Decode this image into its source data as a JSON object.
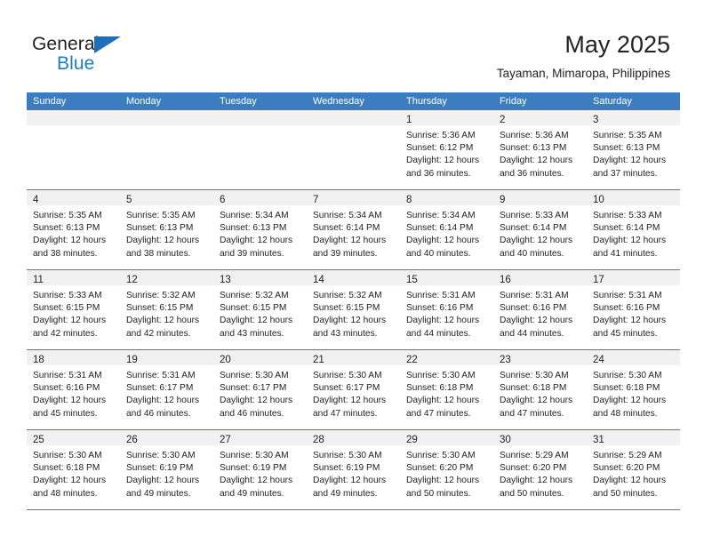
{
  "brand": {
    "name_part1": "General",
    "name_part2": "Blue",
    "color_dark": "#231f20",
    "color_blue": "#1e7bc4"
  },
  "header": {
    "title": "May 2025",
    "subtitle": "Tayaman, Mimaropa, Philippines"
  },
  "theme": {
    "header_bar_color": "#3b7dc0",
    "day_band_color": "#f1f1f1",
    "row_divider_color": "#3b7dc0",
    "text_color": "#222222"
  },
  "weekdays": [
    "Sunday",
    "Monday",
    "Tuesday",
    "Wednesday",
    "Thursday",
    "Friday",
    "Saturday"
  ],
  "weeks": [
    {
      "days": [
        {
          "number": "",
          "lines": []
        },
        {
          "number": "",
          "lines": []
        },
        {
          "number": "",
          "lines": []
        },
        {
          "number": "",
          "lines": []
        },
        {
          "number": "1",
          "lines": [
            "Sunrise: 5:36 AM",
            "Sunset: 6:12 PM",
            "Daylight: 12 hours",
            "and 36 minutes."
          ]
        },
        {
          "number": "2",
          "lines": [
            "Sunrise: 5:36 AM",
            "Sunset: 6:13 PM",
            "Daylight: 12 hours",
            "and 36 minutes."
          ]
        },
        {
          "number": "3",
          "lines": [
            "Sunrise: 5:35 AM",
            "Sunset: 6:13 PM",
            "Daylight: 12 hours",
            "and 37 minutes."
          ]
        }
      ]
    },
    {
      "days": [
        {
          "number": "4",
          "lines": [
            "Sunrise: 5:35 AM",
            "Sunset: 6:13 PM",
            "Daylight: 12 hours",
            "and 38 minutes."
          ]
        },
        {
          "number": "5",
          "lines": [
            "Sunrise: 5:35 AM",
            "Sunset: 6:13 PM",
            "Daylight: 12 hours",
            "and 38 minutes."
          ]
        },
        {
          "number": "6",
          "lines": [
            "Sunrise: 5:34 AM",
            "Sunset: 6:13 PM",
            "Daylight: 12 hours",
            "and 39 minutes."
          ]
        },
        {
          "number": "7",
          "lines": [
            "Sunrise: 5:34 AM",
            "Sunset: 6:14 PM",
            "Daylight: 12 hours",
            "and 39 minutes."
          ]
        },
        {
          "number": "8",
          "lines": [
            "Sunrise: 5:34 AM",
            "Sunset: 6:14 PM",
            "Daylight: 12 hours",
            "and 40 minutes."
          ]
        },
        {
          "number": "9",
          "lines": [
            "Sunrise: 5:33 AM",
            "Sunset: 6:14 PM",
            "Daylight: 12 hours",
            "and 40 minutes."
          ]
        },
        {
          "number": "10",
          "lines": [
            "Sunrise: 5:33 AM",
            "Sunset: 6:14 PM",
            "Daylight: 12 hours",
            "and 41 minutes."
          ]
        }
      ]
    },
    {
      "days": [
        {
          "number": "11",
          "lines": [
            "Sunrise: 5:33 AM",
            "Sunset: 6:15 PM",
            "Daylight: 12 hours",
            "and 42 minutes."
          ]
        },
        {
          "number": "12",
          "lines": [
            "Sunrise: 5:32 AM",
            "Sunset: 6:15 PM",
            "Daylight: 12 hours",
            "and 42 minutes."
          ]
        },
        {
          "number": "13",
          "lines": [
            "Sunrise: 5:32 AM",
            "Sunset: 6:15 PM",
            "Daylight: 12 hours",
            "and 43 minutes."
          ]
        },
        {
          "number": "14",
          "lines": [
            "Sunrise: 5:32 AM",
            "Sunset: 6:15 PM",
            "Daylight: 12 hours",
            "and 43 minutes."
          ]
        },
        {
          "number": "15",
          "lines": [
            "Sunrise: 5:31 AM",
            "Sunset: 6:16 PM",
            "Daylight: 12 hours",
            "and 44 minutes."
          ]
        },
        {
          "number": "16",
          "lines": [
            "Sunrise: 5:31 AM",
            "Sunset: 6:16 PM",
            "Daylight: 12 hours",
            "and 44 minutes."
          ]
        },
        {
          "number": "17",
          "lines": [
            "Sunrise: 5:31 AM",
            "Sunset: 6:16 PM",
            "Daylight: 12 hours",
            "and 45 minutes."
          ]
        }
      ]
    },
    {
      "days": [
        {
          "number": "18",
          "lines": [
            "Sunrise: 5:31 AM",
            "Sunset: 6:16 PM",
            "Daylight: 12 hours",
            "and 45 minutes."
          ]
        },
        {
          "number": "19",
          "lines": [
            "Sunrise: 5:31 AM",
            "Sunset: 6:17 PM",
            "Daylight: 12 hours",
            "and 46 minutes."
          ]
        },
        {
          "number": "20",
          "lines": [
            "Sunrise: 5:30 AM",
            "Sunset: 6:17 PM",
            "Daylight: 12 hours",
            "and 46 minutes."
          ]
        },
        {
          "number": "21",
          "lines": [
            "Sunrise: 5:30 AM",
            "Sunset: 6:17 PM",
            "Daylight: 12 hours",
            "and 47 minutes."
          ]
        },
        {
          "number": "22",
          "lines": [
            "Sunrise: 5:30 AM",
            "Sunset: 6:18 PM",
            "Daylight: 12 hours",
            "and 47 minutes."
          ]
        },
        {
          "number": "23",
          "lines": [
            "Sunrise: 5:30 AM",
            "Sunset: 6:18 PM",
            "Daylight: 12 hours",
            "and 47 minutes."
          ]
        },
        {
          "number": "24",
          "lines": [
            "Sunrise: 5:30 AM",
            "Sunset: 6:18 PM",
            "Daylight: 12 hours",
            "and 48 minutes."
          ]
        }
      ]
    },
    {
      "days": [
        {
          "number": "25",
          "lines": [
            "Sunrise: 5:30 AM",
            "Sunset: 6:18 PM",
            "Daylight: 12 hours",
            "and 48 minutes."
          ]
        },
        {
          "number": "26",
          "lines": [
            "Sunrise: 5:30 AM",
            "Sunset: 6:19 PM",
            "Daylight: 12 hours",
            "and 49 minutes."
          ]
        },
        {
          "number": "27",
          "lines": [
            "Sunrise: 5:30 AM",
            "Sunset: 6:19 PM",
            "Daylight: 12 hours",
            "and 49 minutes."
          ]
        },
        {
          "number": "28",
          "lines": [
            "Sunrise: 5:30 AM",
            "Sunset: 6:19 PM",
            "Daylight: 12 hours",
            "and 49 minutes."
          ]
        },
        {
          "number": "29",
          "lines": [
            "Sunrise: 5:30 AM",
            "Sunset: 6:20 PM",
            "Daylight: 12 hours",
            "and 50 minutes."
          ]
        },
        {
          "number": "30",
          "lines": [
            "Sunrise: 5:29 AM",
            "Sunset: 6:20 PM",
            "Daylight: 12 hours",
            "and 50 minutes."
          ]
        },
        {
          "number": "31",
          "lines": [
            "Sunrise: 5:29 AM",
            "Sunset: 6:20 PM",
            "Daylight: 12 hours",
            "and 50 minutes."
          ]
        }
      ]
    }
  ]
}
